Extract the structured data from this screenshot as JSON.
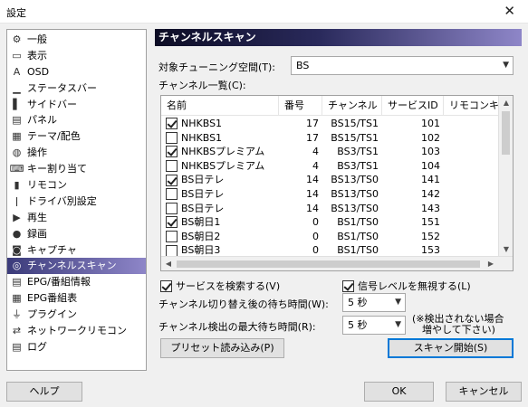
{
  "window": {
    "title": "設定",
    "close_glyph": "✕"
  },
  "sidebar": {
    "items": [
      {
        "label": "一般",
        "icon": "gear-icon",
        "glyph": "⚙"
      },
      {
        "label": "表示",
        "icon": "display-icon",
        "glyph": "▭"
      },
      {
        "label": "OSD",
        "icon": "osd-icon",
        "glyph": "A"
      },
      {
        "label": "ステータスバー",
        "icon": "statusbar-icon",
        "glyph": "▁"
      },
      {
        "label": "サイドバー",
        "icon": "sidebar-icon",
        "glyph": "▌"
      },
      {
        "label": "パネル",
        "icon": "panel-icon",
        "glyph": "▤"
      },
      {
        "label": "テーマ/配色",
        "icon": "palette-icon",
        "glyph": "▦"
      },
      {
        "label": "操作",
        "icon": "mouse-icon",
        "glyph": "◍"
      },
      {
        "label": "キー割り当て",
        "icon": "keyboard-icon",
        "glyph": "⌨"
      },
      {
        "label": "リモコン",
        "icon": "remote-icon",
        "glyph": "▮"
      },
      {
        "label": "ドライバ別設定",
        "icon": "driver-icon",
        "glyph": "ǀ"
      },
      {
        "label": "再生",
        "icon": "play-icon",
        "glyph": "▶"
      },
      {
        "label": "録画",
        "icon": "record-icon",
        "glyph": "●"
      },
      {
        "label": "キャプチャ",
        "icon": "camera-icon",
        "glyph": "◙"
      },
      {
        "label": "チャンネルスキャン",
        "icon": "antenna-icon",
        "glyph": "◎",
        "selected": true
      },
      {
        "label": "EPG/番組情報",
        "icon": "epg-icon",
        "glyph": "▤"
      },
      {
        "label": "EPG番組表",
        "icon": "program-guide-icon",
        "glyph": "▦"
      },
      {
        "label": "プラグイン",
        "icon": "plugin-icon",
        "glyph": "⏚"
      },
      {
        "label": "ネットワークリモコン",
        "icon": "network-remote-icon",
        "glyph": "⇄"
      },
      {
        "label": "ログ",
        "icon": "log-icon",
        "glyph": "▤"
      }
    ]
  },
  "panel": {
    "title": "チャンネルスキャン",
    "tuning_space_label": "対象チューニング空間(T):",
    "tuning_space_value": "BS",
    "channel_list_label": "チャンネル一覧(C):",
    "columns": [
      "名前",
      "番号",
      "チャンネル",
      "サービスID",
      "リモコンキー"
    ],
    "rows": [
      {
        "checked": true,
        "name": "NHKBS1",
        "num": "17",
        "ch": "BS15/TS1",
        "sid": "101"
      },
      {
        "checked": false,
        "name": "NHKBS1",
        "num": "17",
        "ch": "BS15/TS1",
        "sid": "102"
      },
      {
        "checked": true,
        "name": "NHKBSプレミアム",
        "num": "4",
        "ch": "BS3/TS1",
        "sid": "103"
      },
      {
        "checked": false,
        "name": "NHKBSプレミアム",
        "num": "4",
        "ch": "BS3/TS1",
        "sid": "104"
      },
      {
        "checked": true,
        "name": "BS日テレ",
        "num": "14",
        "ch": "BS13/TS0",
        "sid": "141"
      },
      {
        "checked": false,
        "name": "BS日テレ",
        "num": "14",
        "ch": "BS13/TS0",
        "sid": "142"
      },
      {
        "checked": false,
        "name": "BS日テレ",
        "num": "14",
        "ch": "BS13/TS0",
        "sid": "143"
      },
      {
        "checked": true,
        "name": "BS朝日1",
        "num": "0",
        "ch": "BS1/TS0",
        "sid": "151"
      },
      {
        "checked": false,
        "name": "BS朝日2",
        "num": "0",
        "ch": "BS1/TS0",
        "sid": "152"
      },
      {
        "checked": false,
        "name": "BS朝日3",
        "num": "0",
        "ch": "BS1/TS0",
        "sid": "153"
      }
    ],
    "search_service_label": "サービスを検索する(V)",
    "search_service_checked": true,
    "ignore_signal_label": "信号レベルを無視する(L)",
    "ignore_signal_checked": true,
    "wait_after_switch_label": "チャンネル切り替え後の待ち時間(W):",
    "wait_after_switch_value": "5 秒",
    "max_detect_wait_label": "チャンネル検出の最大待ち時間(R):",
    "max_detect_wait_value": "5 秒",
    "note_line1": "(※検出されない場合",
    "note_line2": "増やして下さい)",
    "preset_button": "プリセット読み込み(P)",
    "scan_button": "スキャン開始(S)"
  },
  "footer": {
    "help": "ヘルプ",
    "ok": "OK",
    "cancel": "キャンセル"
  }
}
